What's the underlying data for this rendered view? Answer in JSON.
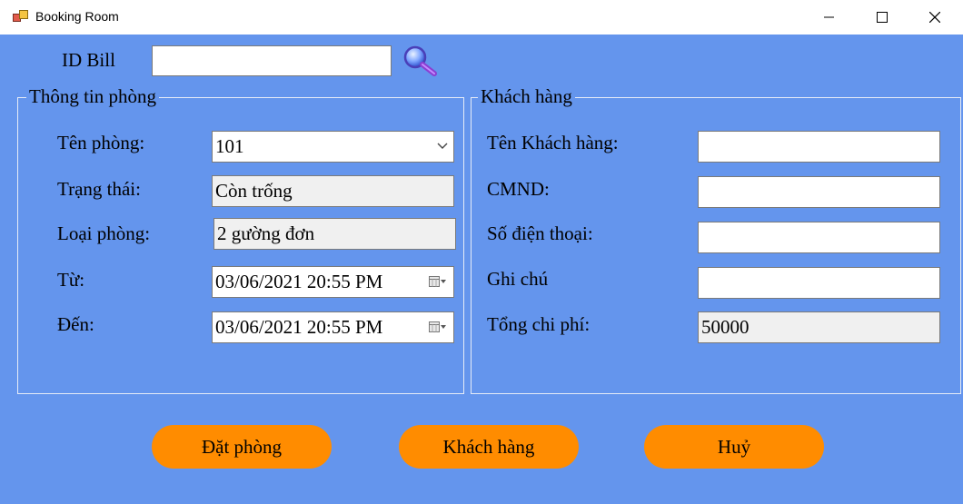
{
  "window": {
    "title": "Booking Room",
    "icons": {
      "app": "app-icon",
      "minimize": "minimize-icon",
      "maximize": "maximize-icon",
      "close": "close-icon"
    }
  },
  "search": {
    "label": "ID Bill",
    "value": "",
    "icon": "search-icon"
  },
  "room_info": {
    "title": "Thông tin phòng",
    "room_name_label": "Tên phòng:",
    "room_name_value": "101",
    "status_label": "Trạng thái:",
    "status_value": "Còn trống",
    "room_type_label": "Loại phòng:",
    "room_type_value": "2 gường đơn",
    "from_label": "Từ:",
    "from_value": "03/06/2021 20:55  PM",
    "to_label": "Đến:",
    "to_value": "03/06/2021 20:55  PM"
  },
  "customer": {
    "title": "Khách hàng",
    "name_label": "Tên Khách hàng:",
    "name_value": "",
    "id_label": "CMND:",
    "id_value": "",
    "phone_label": "Số điện thoại:",
    "phone_value": "",
    "note_label": "Ghi chú",
    "note_value": "",
    "total_label": "Tổng chi phí:",
    "total_value": "50000"
  },
  "actions": {
    "book": "Đặt phòng",
    "customers": "Khách hàng",
    "cancel": "Huỷ"
  },
  "colors": {
    "background": "#6495ed",
    "button": "#ff8c00",
    "readonly": "#f0f0f0"
  }
}
